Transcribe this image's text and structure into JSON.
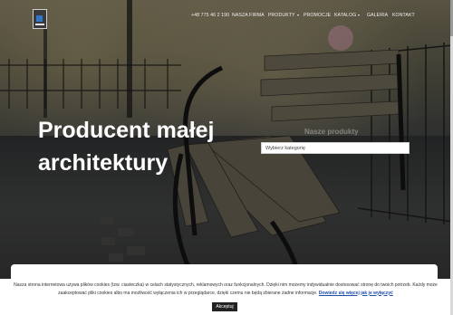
{
  "nav": {
    "phone": "+48 775 46 2 190",
    "items": [
      {
        "label": "NASZA FIRMA",
        "dropdown": false
      },
      {
        "label": "PRODUKTY",
        "dropdown": true
      },
      {
        "label": "PROMOCJE",
        "dropdown": false
      },
      {
        "label": "KATALOG",
        "dropdown": true
      },
      {
        "label": "GALERIA",
        "dropdown": false
      },
      {
        "label": "KONTAKT",
        "dropdown": false
      }
    ]
  },
  "hero": {
    "title_line1": "Producent małej",
    "title_line2": "architektury"
  },
  "products": {
    "title": "Nasze produkty",
    "select_placeholder": "Wybierz kategorię"
  },
  "cookie": {
    "text": "Nasza strona internetowa używa plików cookies (tzw. ciasteczka) w celach statystycznych, reklamowych oraz funkcjonalnych. Dzięki nim możemy indywidualnie dostosować stronę do twoich potrzeb. Każdy może zaakceptować pliki cookies albo ma możliwość wyłączenia ich w przeglądarce, dzięki czemu nie będą zbierane żadne informacje.",
    "link": "Dowiedz się więcej jak je wyłączyć",
    "accept_label": "Akceptuj"
  },
  "colors": {
    "logo_accent": "#2f78c8",
    "link": "#1f4fa8",
    "button_bg": "#222222"
  },
  "icons": {
    "logo": "company-logo",
    "caret": "caret-down-icon"
  }
}
